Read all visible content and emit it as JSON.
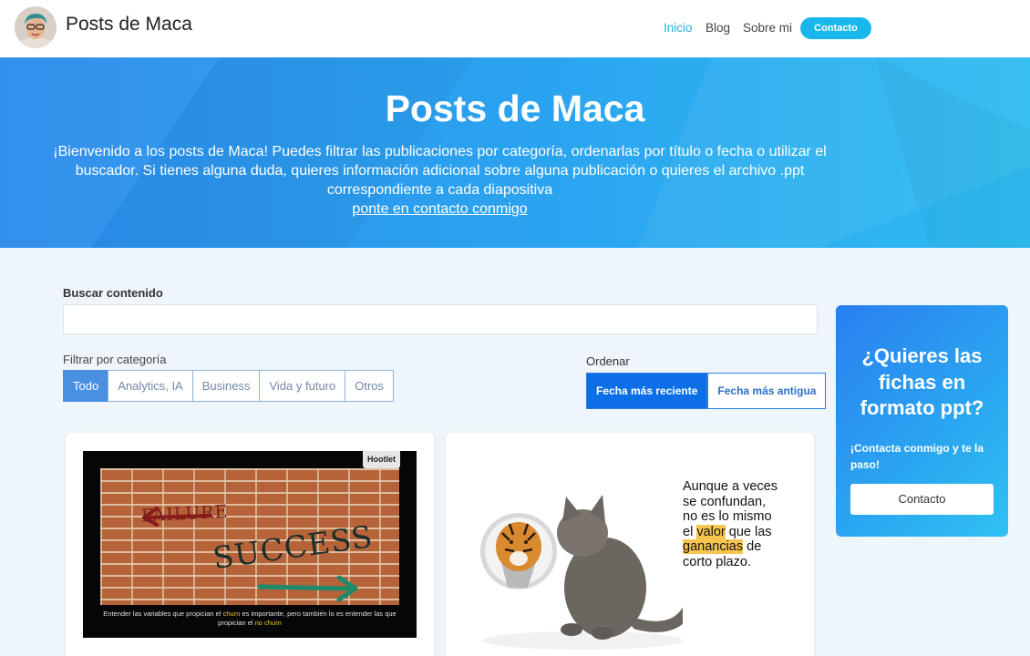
{
  "nav": {
    "brand": "Posts de Maca",
    "links": [
      "Inicio",
      "Blog",
      "Sobre mi"
    ],
    "cta": "Contacto"
  },
  "hero": {
    "title": "Posts de Maca",
    "text": "¡Bienvenido a los posts de Maca! Puedes filtrar las publicaciones por categoría, ordenarlas por título o fecha o utilizar el buscador. Si tienes alguna duda, quieres información adicional sobre alguna publicación o quieres el archivo .ppt correspondiente a cada diapositiva",
    "link": "ponte en contacto conmigo"
  },
  "search": {
    "label": "Buscar contenido",
    "value": ""
  },
  "filter": {
    "label": "Filtrar por categoría",
    "options": [
      "Todo",
      "Analytics, IA",
      "Business",
      "Vida y futuro",
      "Otros"
    ],
    "selected": "Todo"
  },
  "sort": {
    "label": "Ordenar",
    "options": [
      "Fecha más reciente",
      "Fecha más antigua"
    ],
    "selected": "Fecha más reciente"
  },
  "posts": [
    {
      "badge": "Hootlet",
      "word_failure": "FAILURE",
      "word_success": "SUCCESS",
      "caption": {
        "p1": "Entender las variables que propician el ",
        "h1": "churn",
        "p2": " es importante, pero también lo es entender las que propician el ",
        "h2": "no churn"
      }
    },
    {
      "quote": {
        "line1": "Aunque a veces",
        "line2": "se confundan,",
        "line3": "no es lo mismo",
        "l4a": "el ",
        "l4b": "valor",
        "l4c": " que las",
        "l5a": "ganancias",
        "l5b": " de",
        "line6": "corto plazo."
      }
    }
  ],
  "sidebar": {
    "title": "¿Quieres las fichas en formato ppt?",
    "subtitle": "¡Contacta conmigo y te la paso!",
    "button": "Contacto"
  },
  "colors": {
    "accent": "#1ab7ec",
    "nav_active": "#23aee2",
    "filter_active": "#4a90e2",
    "sort_active": "#0d6fe8"
  }
}
